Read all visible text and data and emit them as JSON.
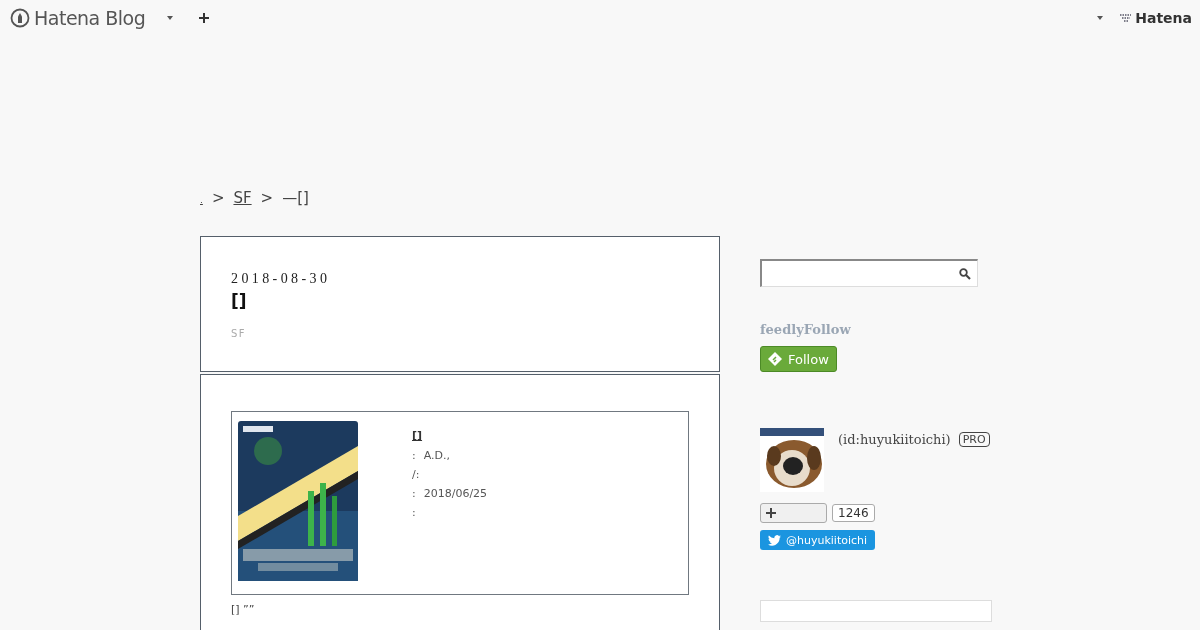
{
  "header": {
    "logo": "Hatena Blog",
    "right_logo": "Hatena"
  },
  "breadcrumb": [
    {
      "kind": "link",
      "text": "."
    },
    {
      "kind": "sep",
      "text": ">"
    },
    {
      "kind": "link",
      "text": "SF"
    },
    {
      "kind": "sep",
      "text": ">"
    },
    {
      "kind": "current",
      "text": "—[]"
    }
  ],
  "entry": {
    "date": "2018-08-30",
    "title": "[]",
    "category": "SF"
  },
  "product": {
    "title": "[]",
    "details": [
      {
        "label": ":",
        "value": "A.D.,"
      },
      {
        "label": "/:"
      },
      {
        "label": ":",
        "value": "2018/06/25"
      },
      {
        "label": ":"
      }
    ]
  },
  "body_text": "[] ””",
  "sidebar": {
    "feedly_heading": "feedlyFollow",
    "feedly_button": "Follow",
    "profile": {
      "id": "(id:huyukiitoichi)",
      "badge": "PRO"
    },
    "bookmark_count": "1246",
    "twitter": "@huyukiitoichi"
  }
}
